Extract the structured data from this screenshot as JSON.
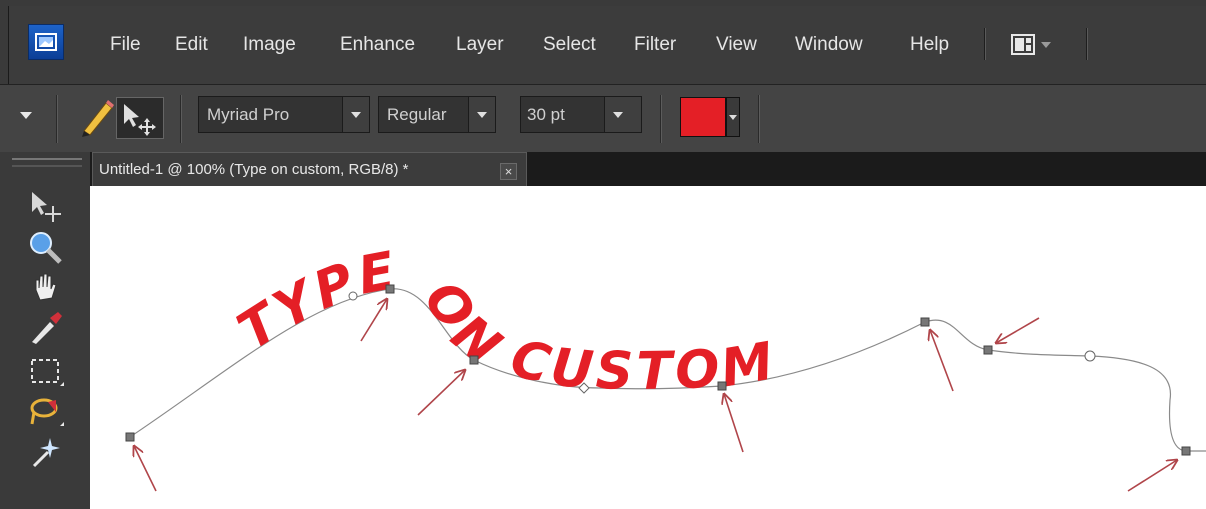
{
  "menu": {
    "items": [
      "File",
      "Edit",
      "Image",
      "Enhance",
      "Layer",
      "Select",
      "Filter",
      "View",
      "Window",
      "Help"
    ]
  },
  "options": {
    "font_family": "Myriad Pro",
    "font_style": "Regular",
    "font_size": "30 pt",
    "text_color": "#e41f26"
  },
  "document": {
    "tab_title": "Untitled-1 @ 100% (Type on custom, RGB/8) *",
    "close_glyph": "×"
  },
  "canvas": {
    "path_text": "TYPE ON CUSTOM",
    "text_color": "#e41f26",
    "arrow_color": "#b0454a"
  },
  "toolbox": {
    "tools": [
      "move-tool-icon",
      "zoom-tool-icon",
      "hand-tool-icon",
      "eyedropper-tool-icon",
      "marquee-tool-icon",
      "lasso-tool-icon",
      "magic-wand-tool-icon"
    ]
  }
}
